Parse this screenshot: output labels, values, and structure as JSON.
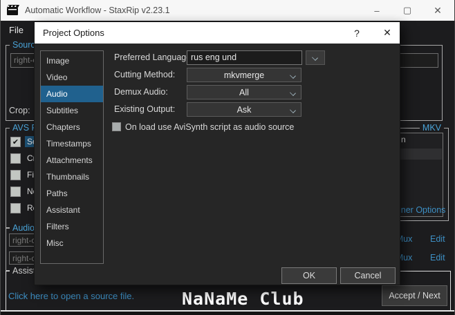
{
  "colors": {
    "window_bg": "#1c1c1e",
    "titlebar_bg": "#f7f7f7",
    "accent_blue": "#4aa3d8",
    "link_blue": "#3d8fc4",
    "selection_blue": "#20618e",
    "dialog_bg": "#262626",
    "button_bg": "#3a3a3a"
  },
  "window": {
    "title": "Automatic Workflow - StaxRip v2.23.1",
    "caption_buttons": {
      "minimize": "–",
      "maximize": "▢",
      "close": "✕"
    },
    "menu_file": "File",
    "source_group_label": "Source",
    "source_input_value": "right-cl",
    "crop_label": "Crop:",
    "avs_group_label": "AVS Filt",
    "avs_items": [
      {
        "label": "Sou",
        "check": "✔"
      },
      {
        "label": "Cro",
        "check": ""
      },
      {
        "label": "Fie",
        "check": ""
      },
      {
        "label": "No",
        "check": ""
      },
      {
        "label": "Res",
        "check": ""
      }
    ],
    "mkv_group_label": "MKV",
    "mkv_list_item": "n",
    "container_options_link": "iner Options",
    "audio_group_label": "Audio",
    "audio_inputs": [
      "right-cl",
      "right-cl"
    ],
    "mux_rows": [
      {
        "mux": "y/Mux",
        "edit": "Edit"
      },
      {
        "mux": "y/Mux",
        "edit": "Edit"
      }
    ],
    "assistant_group_label": "Assista",
    "assistant_link": "Click here to open a source file.",
    "watermark": "NaNaMe Club",
    "accept_button": "Accept / Next"
  },
  "dialog": {
    "title": "Project Options",
    "help_button": "?",
    "close_button": "✕",
    "sidebar": {
      "items": [
        "Image",
        "Video",
        "Audio",
        "Subtitles",
        "Chapters",
        "Timestamps",
        "Attachments",
        "Thumbnails",
        "Paths",
        "Assistant",
        "Filters",
        "Misc"
      ],
      "selected": "Audio"
    },
    "fields": {
      "preferred_languages": {
        "label": "Preferred Languages:",
        "value": "rus eng und"
      },
      "cutting_method": {
        "label": "Cutting Method:",
        "value": "mkvmerge"
      },
      "demux_audio": {
        "label": "Demux Audio:",
        "value": "All"
      },
      "existing_output": {
        "label": "Existing Output:",
        "value": "Ask"
      }
    },
    "checkbox_label": "On load use AviSynth script as audio source",
    "ok_button": "OK",
    "cancel_button": "Cancel"
  }
}
